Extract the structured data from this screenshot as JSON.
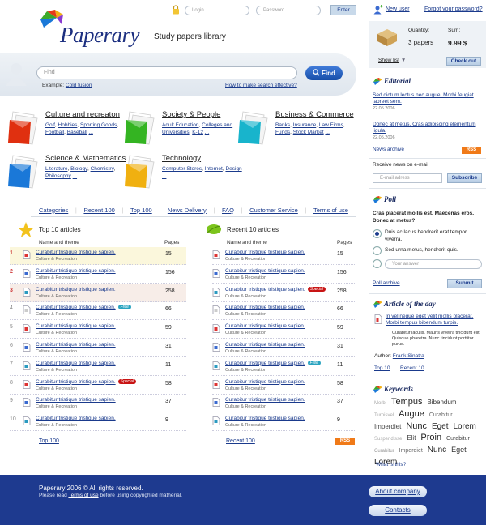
{
  "brand": {
    "name": "Paperary",
    "tagline": "Study papers library"
  },
  "login": {
    "login_placeholder": "Login",
    "password_placeholder": "Password",
    "enter_label": "Enter"
  },
  "account": {
    "new_user": "New user",
    "forgot": "Forgot your password?"
  },
  "cart": {
    "quantity_label": "Quantity:",
    "quantity_value": "3 papers",
    "sum_label": "Sum:",
    "sum_value": "9.99 $",
    "show_list": "Show list",
    "checkout": "Check out"
  },
  "search": {
    "placeholder": "Find",
    "find_label": "Find",
    "example_label": "Example:",
    "example_link": "Cold fusion",
    "how_link": "How to make search effective?"
  },
  "categories": [
    {
      "title": "Culture and recreaton",
      "links": [
        "Golf",
        "Hobbies",
        "Sporting Goods",
        "Football",
        "Baseball",
        "..."
      ],
      "color": "#e03010"
    },
    {
      "title": "Society & People",
      "links": [
        "Adult Education",
        "Colleges and Universities",
        "K-12",
        "..."
      ],
      "color": "#34b422"
    },
    {
      "title": "Business & Commerce",
      "links": [
        "Banks",
        "Insurance",
        "Law Firms",
        "Funds",
        "Stock Market",
        "..."
      ],
      "color": "#18b4cc"
    },
    {
      "title": "Science & Mathematics",
      "links": [
        "Literature",
        "Biology",
        "Chemistry",
        "Philosophy",
        "..."
      ],
      "color": "#1a78d8"
    },
    {
      "title": "Technology",
      "links": [
        "Computer Stores",
        "Internet",
        "Design",
        "..."
      ],
      "color": "#f0b010"
    }
  ],
  "menu": [
    "Categories",
    "Recent 100",
    "Top 100",
    "News Delivery",
    "FAQ",
    "Customer Service",
    "Terms of use"
  ],
  "top10": {
    "title": "Top 10 articles",
    "col_name": "Name and theme",
    "col_pages": "Pages",
    "footer_link": "Top 100",
    "rows": [
      {
        "num": "1",
        "title": "Curabitur tristique tristique sapien.",
        "theme": "Culture & Recreation",
        "pages": "15",
        "badge": ""
      },
      {
        "num": "2",
        "title": "Curabitur tristique tristique sapien.",
        "theme": "Culture & Recreation",
        "pages": "156",
        "badge": ""
      },
      {
        "num": "3",
        "title": "Curabitur tristique tristique sapien.",
        "theme": "Culture & Recreation",
        "pages": "258",
        "badge": ""
      },
      {
        "num": "4",
        "title": "Curabitur tristique tristique sapien.",
        "theme": "Culture & Recreation",
        "pages": "66",
        "badge": "Free"
      },
      {
        "num": "5",
        "title": "Curabitur tristique tristique sapien.",
        "theme": "Culture & Recreation",
        "pages": "59",
        "badge": ""
      },
      {
        "num": "6",
        "title": "Curabitur tristique tristique sapien.",
        "theme": "Culture & Recreation",
        "pages": "31",
        "badge": ""
      },
      {
        "num": "7",
        "title": "Curabitur tristique tristique sapien.",
        "theme": "Culture & Recreation",
        "pages": "11",
        "badge": ""
      },
      {
        "num": "8",
        "title": "Curabitur tristique tristique sapien.",
        "theme": "Culture & Recreation",
        "pages": "58",
        "badge": "Special"
      },
      {
        "num": "9",
        "title": "Curabitur tristique tristique sapien.",
        "theme": "Culture & Recreation",
        "pages": "37",
        "badge": ""
      },
      {
        "num": "10",
        "title": "Curabitur tristique tristique sapien.",
        "theme": "Culture & Recreation",
        "pages": "9",
        "badge": ""
      }
    ]
  },
  "recent10": {
    "title": "Recent 10 articles",
    "col_name": "Name and theme",
    "col_pages": "Pages",
    "footer_link": "Recent 100",
    "rss": "RSS",
    "rows": [
      {
        "title": "Curabitur tristique tristique sapien.",
        "theme": "Culture & Recreation",
        "pages": "15",
        "badge": ""
      },
      {
        "title": "Curabitur tristique tristique sapien.",
        "theme": "Culture & Recreation",
        "pages": "156",
        "badge": ""
      },
      {
        "title": "Curabitur tristique tristique sapien.",
        "theme": "Culture & Recreation",
        "pages": "258",
        "badge": "Special"
      },
      {
        "title": "Curabitur tristique tristique sapien.",
        "theme": "Culture & Recreation",
        "pages": "66",
        "badge": ""
      },
      {
        "title": "Curabitur tristique tristique sapien.",
        "theme": "Culture & Recreation",
        "pages": "59",
        "badge": ""
      },
      {
        "title": "Curabitur tristique tristique sapien.",
        "theme": "Culture & Recreation",
        "pages": "31",
        "badge": ""
      },
      {
        "title": "Curabitur tristique tristique sapien.",
        "theme": "Culture & Recreation",
        "pages": "11",
        "badge": "Free"
      },
      {
        "title": "Curabitur tristique tristique sapien.",
        "theme": "Culture & Recreation",
        "pages": "58",
        "badge": ""
      },
      {
        "title": "Curabitur tristique tristique sapien.",
        "theme": "Culture & Recreation",
        "pages": "37",
        "badge": ""
      },
      {
        "title": "Curabitur tristique tristique sapien.",
        "theme": "Culture & Recreation",
        "pages": "9",
        "badge": ""
      }
    ]
  },
  "editorial": {
    "title": "Editorial",
    "items": [
      {
        "text": "Sed dictum lectus nec augue. Morbi feugiat laoreet sem.",
        "date": "22.05.2006"
      },
      {
        "text": "Donec at metus. Cras adipiscing elementum ligula.",
        "date": "22.05.2006"
      }
    ],
    "archive": "News archive",
    "rss": "RSS"
  },
  "newsletter": {
    "label": "Receive news on e-mail",
    "placeholder": "E-mail adress",
    "subscribe": "Subscribe"
  },
  "poll": {
    "title": "Poll",
    "question": "Cras placerat mollis est. Maecenas eros. Donec at metus?",
    "options": [
      "Duis ac lacus hendrerit erat tempor viverra.",
      "Sed urna metus, hendrerit quis."
    ],
    "answer_placeholder": "Your answer",
    "archive": "Poll archive",
    "submit": "Submit"
  },
  "article_of_day": {
    "title": "Article of the day",
    "link": "In vel neque eget velit mollis placerat. Morbi tempus bibendum turpis.",
    "desc": "Curabitur iaculis. Mauris viverra tincidunt elit. Quisque pharetra. Nunc tincidunt porttitor purus.",
    "author_label": "Author:",
    "author": "Frank Sinatra",
    "top_link": "Top 10",
    "recent_link": "Recent 10"
  },
  "keywords": {
    "title": "Keywords",
    "words": [
      {
        "w": "Morbi",
        "s": 6,
        "c": "#aaa"
      },
      {
        "w": "Tempus",
        "s": 11,
        "c": "#222"
      },
      {
        "w": "Bibendum",
        "s": 8,
        "c": "#333"
      },
      {
        "w": "Turpisvel",
        "s": 6,
        "c": "#aaa"
      },
      {
        "w": "Augue",
        "s": 11,
        "c": "#222"
      },
      {
        "w": "Curabitur",
        "s": 7,
        "c": "#666"
      },
      {
        "w": "Imperdiet",
        "s": 8,
        "c": "#444"
      },
      {
        "w": "Nunc",
        "s": 11,
        "c": "#222"
      },
      {
        "w": "Eget",
        "s": 10,
        "c": "#222"
      },
      {
        "w": "Lorem",
        "s": 10,
        "c": "#222"
      },
      {
        "w": "Suspendisse",
        "s": 6,
        "c": "#aaa"
      },
      {
        "w": "Elit",
        "s": 8,
        "c": "#444"
      },
      {
        "w": "Proin",
        "s": 11,
        "c": "#222"
      },
      {
        "w": "Curabitur",
        "s": 7,
        "c": "#444"
      },
      {
        "w": "Curabitur",
        "s": 6,
        "c": "#999"
      },
      {
        "w": "Imperdiet",
        "s": 7,
        "c": "#666"
      },
      {
        "w": "Nunc",
        "s": 10,
        "c": "#222"
      },
      {
        "w": "Eget",
        "s": 9,
        "c": "#333"
      },
      {
        "w": "Lorem",
        "s": 10,
        "c": "#222"
      }
    ],
    "what_link": "What is this?"
  },
  "footer": {
    "copyright": "Paperary 2006 © All rights reserved.",
    "terms_pre": "Please read",
    "terms_link": "Terms of use",
    "terms_post": "before using copyrighted matherial.",
    "about": "About company",
    "contacts": "Contacts"
  },
  "colors": {
    "brand_blue": "#1c2f80",
    "footer_bg": "#1e3a8f",
    "link": "#1a3a8c",
    "highlight_row_1": "#fbf7dc",
    "highlight_row_3": "#f7ede8"
  }
}
